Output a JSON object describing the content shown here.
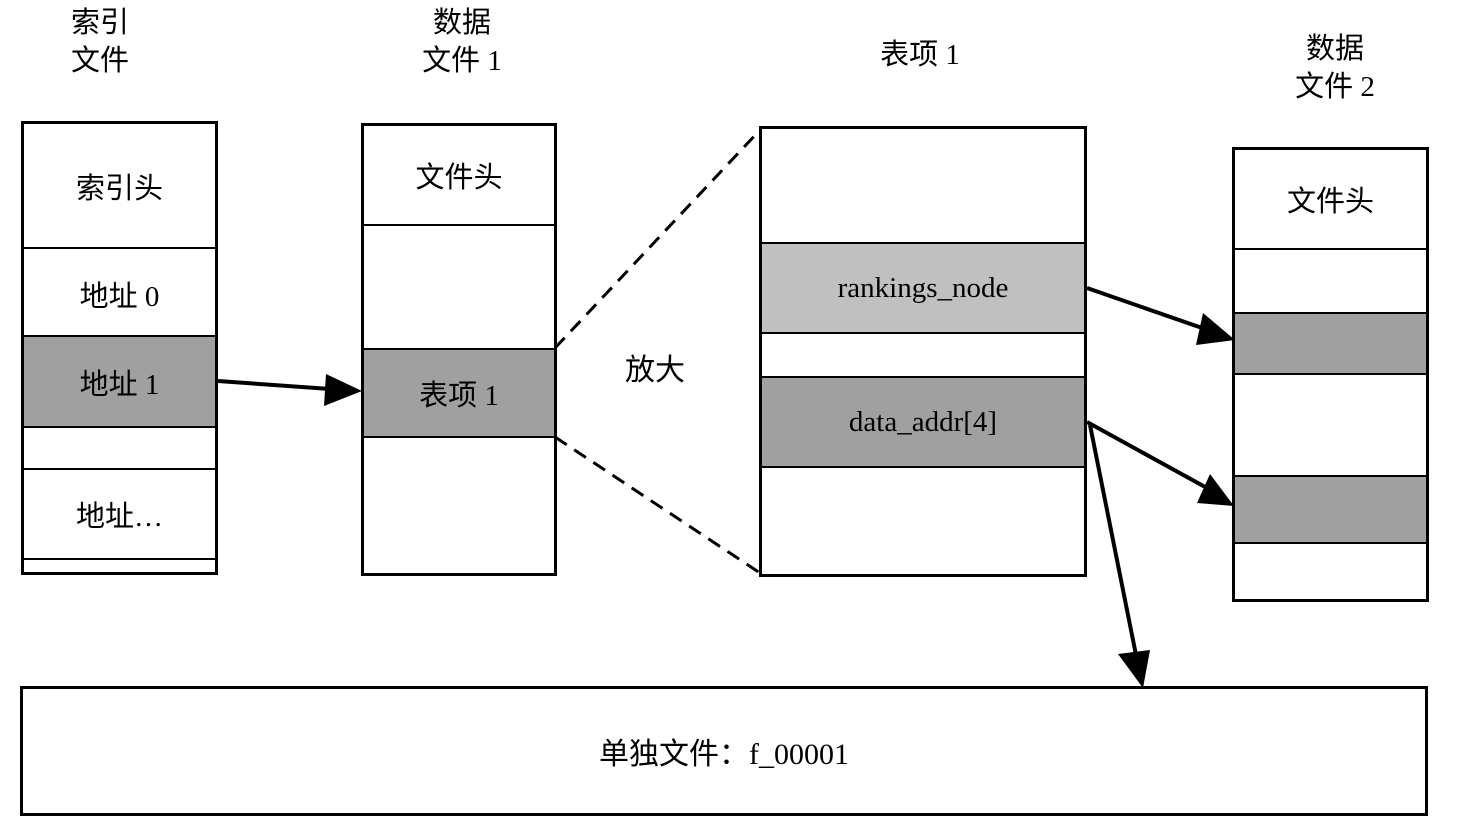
{
  "index_file": {
    "title_line1": "索引",
    "title_line2": "文件",
    "rows": [
      "索引头",
      "地址 0",
      "地址 1",
      "地址…"
    ]
  },
  "data_file_1": {
    "title_line1": "数据",
    "title_line2": "文件 1",
    "rows": [
      "文件头",
      "表项 1"
    ]
  },
  "zoom_label": "放大",
  "entry": {
    "title": "表项 1",
    "rows": [
      "rankings_node",
      "data_addr[4]"
    ]
  },
  "data_file_2": {
    "title_line1": "数据",
    "title_line2": "文件 2",
    "rows": [
      "文件头"
    ]
  },
  "single_file": {
    "label": "单独文件：f_00001"
  },
  "colors": {
    "dark_fill": "#a0a0a0",
    "light_fill": "#c0c0c0",
    "stroke": "#000000"
  }
}
